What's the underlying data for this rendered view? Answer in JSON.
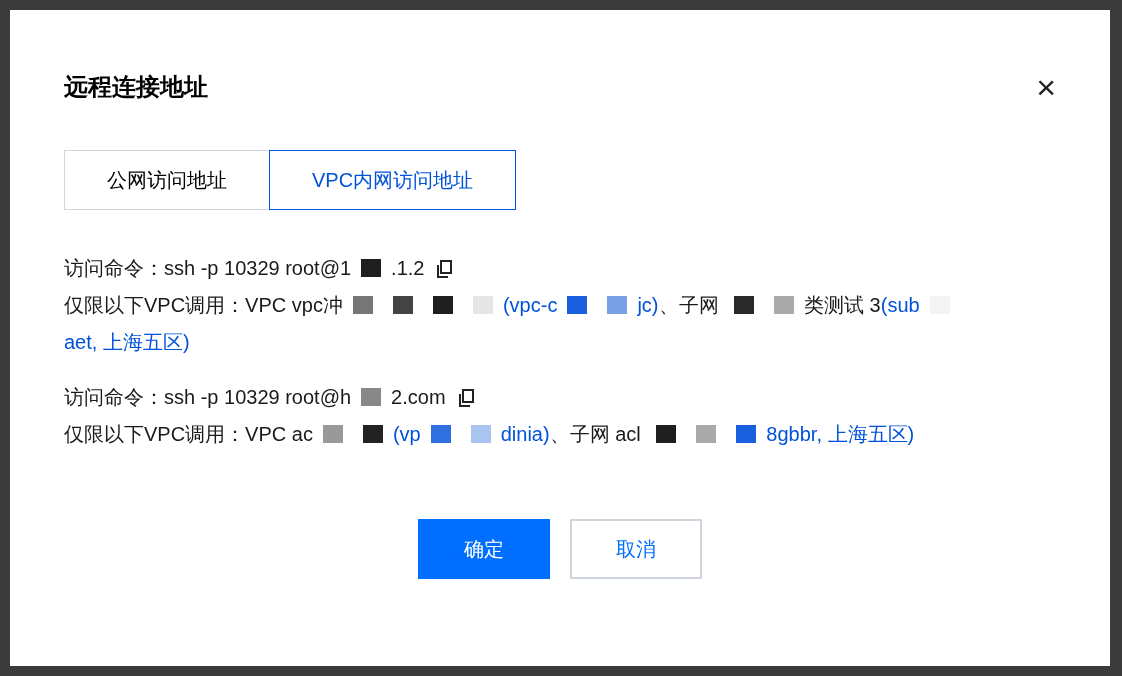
{
  "dialog": {
    "title": "远程连接地址",
    "close": "×"
  },
  "tabs": [
    {
      "label": "公网访问地址",
      "selected": false
    },
    {
      "label": "VPC内网访问地址",
      "selected": true
    }
  ],
  "entries": [
    {
      "command": [
        {
          "kind": "text",
          "text": "访问命令：ssh -p 10329 root@1"
        },
        {
          "kind": "redacted",
          "color": "#1e1e1e"
        },
        {
          "kind": "text",
          "text": ".1.2"
        }
      ],
      "scope": [
        {
          "kind": "text",
          "text": "仅限以下VPC调用：VPC vpc冲"
        },
        {
          "kind": "redacted",
          "color": "#777777"
        },
        {
          "kind": "redacted",
          "color": "#444444"
        },
        {
          "kind": "redacted",
          "color": "#1e1e1e"
        },
        {
          "kind": "redacted",
          "color": "#e6e6e6"
        },
        {
          "kind": "link",
          "text": "(vpc-c"
        },
        {
          "kind": "redacted",
          "color": "#1a5fe0"
        },
        {
          "kind": "redacted",
          "color": "#7aa0e6"
        },
        {
          "kind": "link",
          "text": "jc)"
        },
        {
          "kind": "text",
          "text": "、子网 "
        },
        {
          "kind": "redacted",
          "color": "#2a2a2a"
        },
        {
          "kind": "redacted",
          "color": "#aaaaaa"
        },
        {
          "kind": "text",
          "text": "类测试 3"
        },
        {
          "kind": "link",
          "text": "(sub"
        },
        {
          "kind": "redacted",
          "color": "#f4f4f4"
        },
        {
          "kind": "link",
          "text": "aet, 上海五区)"
        }
      ]
    },
    {
      "command": [
        {
          "kind": "text",
          "text": "访问命令：ssh -p 10329 root@h"
        },
        {
          "kind": "redacted",
          "color": "#888888"
        },
        {
          "kind": "text",
          "text": "2.com"
        }
      ],
      "scope": [
        {
          "kind": "text",
          "text": "仅限以下VPC调用：VPC ac"
        },
        {
          "kind": "redacted",
          "color": "#999999"
        },
        {
          "kind": "redacted",
          "color": "#222222"
        },
        {
          "kind": "link",
          "text": "(vp"
        },
        {
          "kind": "redacted",
          "color": "#2f6fe0"
        },
        {
          "kind": "redacted",
          "color": "#aac4f0"
        },
        {
          "kind": "link",
          "text": "dinia)"
        },
        {
          "kind": "text",
          "text": "、子网 acl "
        },
        {
          "kind": "redacted",
          "color": "#1e1e1e"
        },
        {
          "kind": "redacted",
          "color": "#aaaaaa"
        },
        {
          "kind": "redacted",
          "color": "#1a5fe0"
        },
        {
          "kind": "link",
          "text": "8gbbr, 上海五区)"
        }
      ]
    }
  ],
  "buttons": [
    {
      "label": "确定",
      "kind": "primary"
    },
    {
      "label": "取消",
      "kind": "secondary"
    }
  ]
}
